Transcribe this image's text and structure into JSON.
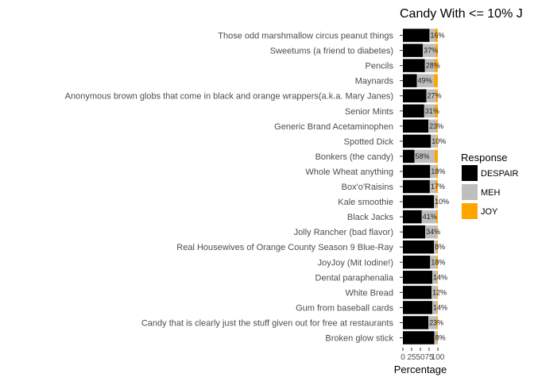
{
  "chart_data": {
    "type": "bar",
    "orientation": "horizontal",
    "stacked": true,
    "title": "Candy With <= 10% J",
    "xlabel": "Percentage",
    "ylabel": "",
    "xlim": [
      0,
      100
    ],
    "x_ticks": [
      "0",
      "25",
      "50",
      "75",
      "100"
    ],
    "grid": false,
    "legend": {
      "title": "Response",
      "position": "right",
      "entries": [
        {
          "name": "DESPAIR",
          "color": "#000000"
        },
        {
          "name": "MEH",
          "color": "#bebebe"
        },
        {
          "name": "JOY",
          "color": "#ffa500"
        }
      ]
    },
    "categories": [
      "Those odd marshmallow circus peanut things",
      "Sweetums (a friend to diabetes)",
      "Pencils",
      "Maynards",
      "Anonymous brown globs that come in black and orange wrappers(a.k.a. Mary Janes)",
      "Senior Mints",
      "Generic Brand Acetaminophen",
      "Spotted Dick",
      "Bonkers (the candy)",
      "Whole Wheat anything",
      "Box'o'Raisins",
      "Kale smoothie",
      "Black Jacks",
      "Jolly Rancher (bad flavor)",
      "Real Housewives of Orange County Season 9 Blue-Ray",
      "JoyJoy (Mit Iodine!)",
      "Dental paraphenalia",
      "White Bread",
      "Gum from baseball cards",
      "Candy that is clearly just the stuff given out for free at restaurants",
      "Broken glow stick"
    ],
    "series": [
      {
        "name": "DESPAIR",
        "values": [
          76,
          57,
          63,
          40,
          67,
          61,
          73,
          80,
          33,
          78,
          77,
          89,
          54,
          64,
          89,
          78,
          84,
          82,
          84,
          73,
          90
        ]
      },
      {
        "name": "MEH",
        "values": [
          16,
          37,
          28,
          49,
          27,
          31,
          23,
          17,
          58,
          18,
          17,
          9,
          41,
          34,
          8,
          18,
          14,
          15,
          14,
          23,
          8
        ]
      },
      {
        "name": "JOY",
        "values": [
          8,
          6,
          9,
          11,
          6,
          8,
          4,
          3,
          9,
          4,
          6,
          2,
          5,
          2,
          3,
          4,
          2,
          3,
          2,
          4,
          2
        ]
      }
    ],
    "data_labels": [
      "16%",
      "37%",
      "28%",
      "49%",
      "27%",
      "31%",
      "23%",
      "10%",
      "58%",
      "18%",
      "17%",
      "10%",
      "41%",
      "34%",
      "8%",
      "18%",
      "14%",
      "12%",
      "14%",
      "23%",
      "8%"
    ]
  }
}
